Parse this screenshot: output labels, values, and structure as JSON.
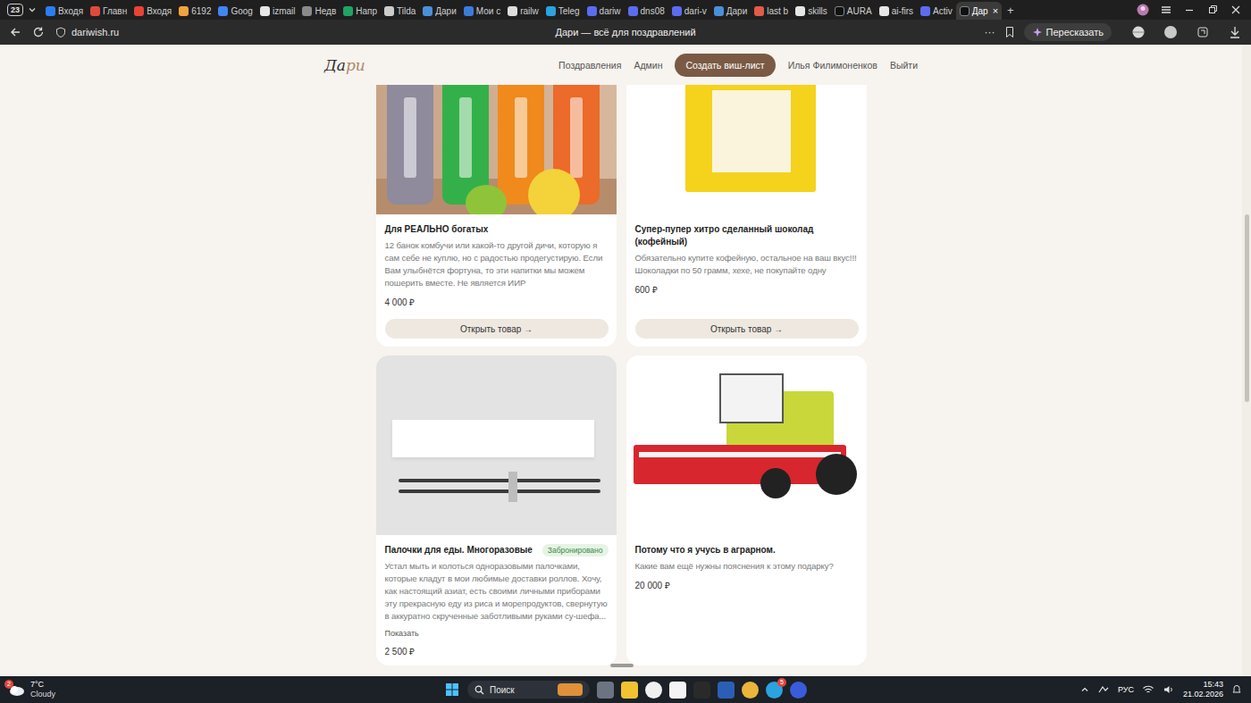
{
  "browser": {
    "tab_count": "23",
    "tabs": [
      {
        "label": "Входя",
        "selected": false,
        "color": "#2a7ef0"
      },
      {
        "label": "Главн",
        "selected": false,
        "color": "#e04a3a"
      },
      {
        "label": "Входя",
        "selected": false,
        "color": "#ea4335"
      },
      {
        "label": "6192",
        "selected": false,
        "color": "#f2a33a"
      },
      {
        "label": "Goog",
        "selected": false,
        "color": "#4285f4"
      },
      {
        "label": "izmail",
        "selected": false,
        "color": "#e6e6e6"
      },
      {
        "label": "Недв",
        "selected": false,
        "color": "#8a8a8a"
      },
      {
        "label": "Напр",
        "selected": false,
        "color": "#1fa463"
      },
      {
        "label": "Tilda",
        "selected": false,
        "color": "#cccccc"
      },
      {
        "label": "Дари",
        "selected": false,
        "color": "#4a90d9"
      },
      {
        "label": "Мои с",
        "selected": false,
        "color": "#3d7bd9"
      },
      {
        "label": "railw",
        "selected": false,
        "color": "#dddddd"
      },
      {
        "label": "Teleg",
        "selected": false,
        "color": "#2aa3e0"
      },
      {
        "label": "dariw",
        "selected": false,
        "color": "#5b6cf0"
      },
      {
        "label": "dns08",
        "selected": false,
        "color": "#5b6cf0"
      },
      {
        "label": "dari-v",
        "selected": false,
        "color": "#5b6cf0"
      },
      {
        "label": "Дари",
        "selected": false,
        "color": "#4a90d9"
      },
      {
        "label": "last b",
        "selected": false,
        "color": "#e25b45"
      },
      {
        "label": "skills",
        "selected": false,
        "color": "#e6e6e6"
      },
      {
        "label": "AURA",
        "selected": false,
        "color": "#111111"
      },
      {
        "label": "ai-firs",
        "selected": false,
        "color": "#e6e6e6"
      },
      {
        "label": "Activ",
        "selected": false,
        "color": "#5b6cf0"
      },
      {
        "label": "Дар",
        "selected": true,
        "color": "#111111"
      }
    ],
    "tab_close": "×",
    "new_tab": "+",
    "address": "dariwish.ru",
    "page_title": "Дари — всё для поздравлений",
    "more": "···",
    "summarize": "Пересказать"
  },
  "site": {
    "logo": [
      "Да",
      "ри"
    ],
    "nav": [
      {
        "label": "Поздравления",
        "kind": "link"
      },
      {
        "label": "Админ",
        "kind": "link"
      },
      {
        "label": "Создать виш-лист",
        "kind": "button"
      },
      {
        "label": "Илья Филимоненков",
        "kind": "link"
      },
      {
        "label": "Выйти",
        "kind": "link"
      }
    ]
  },
  "cards": [
    {
      "title": "Для РЕАЛЬНО богатых",
      "reserved": false,
      "description": "12 банок комбучи или какой-то другой дичи, которую я сам себе не куплю, но с радостью продегустирую. Если Вам улыбнётся фортуна, то эти напитки мы можем пошерить вместе. Не является ИИР",
      "price": "4 000 ₽",
      "button": "Открыть товар →"
    },
    {
      "title": "Супер-пупер хитро сделанный шоколад (кофейный)",
      "reserved": false,
      "description": "Обязательно купите кофейную, остальное на ваш вкус!!! Шоколадки по 50 грамм, хехе, не покупайте одну",
      "price": "600 ₽",
      "button": "Открыть товар →"
    },
    {
      "title": "Палочки для еды. Многоразовые",
      "reserved": true,
      "badge": "Забронировано",
      "description": "Устал мыть и колоться одноразовыми палочками, которые кладут в мои любимые доставки роллов. Хочу, как настоящий азиат, есть своими личными приборами эту прекрасную еду из риса и морепродуктов, свернутую в аккуратно скрученные заботливыми руками су-шефа...",
      "more": "Показать",
      "price": "2 500 ₽"
    },
    {
      "title": "Потому что я учусь в аграрном.",
      "reserved": false,
      "description": "Какие вам ещё нужны пояснения к этому подарку?",
      "price": "20 000 ₽"
    }
  ],
  "taskbar": {
    "weather": {
      "temp": "7°C",
      "condition": "Cloudy",
      "badge": "2"
    },
    "search": "Поиск",
    "telegram_badge": "5",
    "language": "РУС",
    "time": "15:43",
    "date": "21.02.2026"
  }
}
